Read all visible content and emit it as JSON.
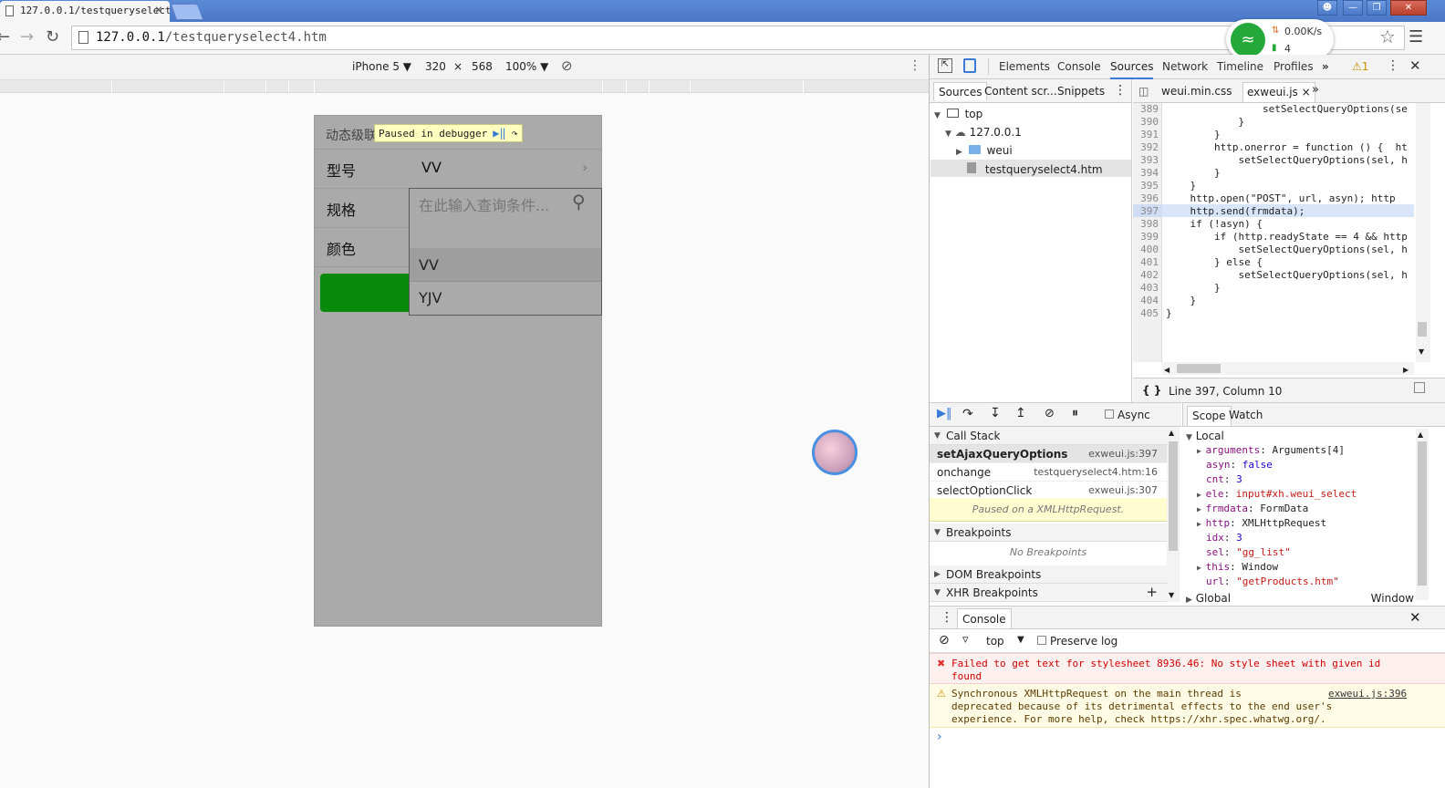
{
  "browser": {
    "tab_title": "127.0.0.1/testqueryselect4.htm",
    "tab_close": "×",
    "url_host": "127.0.0.1",
    "url_path": "/testqueryselect4.htm"
  },
  "wifi": {
    "speed": "0.00K/s",
    "devices": "4"
  },
  "device_toolbar": {
    "device": "iPhone 5",
    "width": "320",
    "times": "×",
    "height": "568",
    "zoom": "100%"
  },
  "phone": {
    "header_title": "动态级联",
    "paused_label": "Paused in debugger",
    "rows": [
      {
        "label": "型号",
        "value": "VV"
      },
      {
        "label": "规格",
        "value": ""
      },
      {
        "label": "颜色",
        "value": ""
      }
    ],
    "dropdown": {
      "placeholder": "在此输入查询条件...",
      "options": [
        "VV",
        "YJV"
      ]
    }
  },
  "devtools": {
    "tabs": [
      "Elements",
      "Console",
      "Sources",
      "Network",
      "Timeline",
      "Profiles"
    ],
    "active_tab": "Sources",
    "warning_count": "1",
    "navigator_tabs": [
      "Sources",
      "Content scr...",
      "Snippets"
    ],
    "tree": [
      {
        "label": "top",
        "depth": 0
      },
      {
        "label": "127.0.0.1",
        "depth": 1
      },
      {
        "label": "weui",
        "depth": 2
      },
      {
        "label": "testqueryselect4.htm",
        "depth": 2
      }
    ],
    "editor_tabs": [
      "weui.min.css",
      "exweui.js"
    ],
    "code_lines": [
      {
        "n": "389",
        "text": "                setSelectQueryOptions(se"
      },
      {
        "n": "390",
        "text": "            }"
      },
      {
        "n": "391",
        "text": "        }"
      },
      {
        "n": "392",
        "text": "        http.onerror = function () {  ht"
      },
      {
        "n": "393",
        "text": "            setSelectQueryOptions(sel, h"
      },
      {
        "n": "394",
        "text": "        }"
      },
      {
        "n": "395",
        "text": "    }"
      },
      {
        "n": "396",
        "text": "    http.open(\"POST\", url, asyn); http"
      },
      {
        "n": "397",
        "text": "    http.send(frmdata);"
      },
      {
        "n": "398",
        "text": "    if (!asyn) {"
      },
      {
        "n": "399",
        "text": "        if (http.readyState == 4 && http"
      },
      {
        "n": "400",
        "text": "            setSelectQueryOptions(sel, h"
      },
      {
        "n": "401",
        "text": "        } else {"
      },
      {
        "n": "402",
        "text": "            setSelectQueryOptions(sel, h"
      },
      {
        "n": "403",
        "text": "        }"
      },
      {
        "n": "404",
        "text": "    }"
      },
      {
        "n": "405",
        "text": "}"
      }
    ],
    "status": "Line 397, Column 10",
    "async_label": "Async",
    "call_stack_title": "Call Stack",
    "call_stack": [
      {
        "fn": "setAjaxQueryOptions",
        "loc": "exweui.js:397"
      },
      {
        "fn": "onchange",
        "loc": "testqueryselect4.htm:16"
      },
      {
        "fn": "selectOptionClick",
        "loc": "exweui.js:307"
      }
    ],
    "paused_msg": "Paused on a XMLHttpRequest.",
    "breakpoints_title": "Breakpoints",
    "no_breakpoints": "No Breakpoints",
    "dom_breakpoints": "DOM Breakpoints",
    "xhr_breakpoints": "XHR Breakpoints",
    "scope_tabs": [
      "Scope",
      "Watch"
    ],
    "scope_local": "Local",
    "scope_vars": [
      {
        "key": "arguments",
        "val": "Arguments[4]",
        "type": "obj",
        "expand": true
      },
      {
        "key": "asyn",
        "val": "false",
        "type": "num",
        "expand": false
      },
      {
        "key": "cnt",
        "val": "3",
        "type": "num",
        "expand": false
      },
      {
        "key": "ele",
        "val": "input#xh.weui_select",
        "type": "str",
        "expand": true
      },
      {
        "key": "frmdata",
        "val": "FormData",
        "type": "obj",
        "expand": true
      },
      {
        "key": "http",
        "val": "XMLHttpRequest",
        "type": "obj",
        "expand": true
      },
      {
        "key": "idx",
        "val": "3",
        "type": "num",
        "expand": false
      },
      {
        "key": "sel",
        "val": "\"gg_list\"",
        "type": "str",
        "expand": false
      },
      {
        "key": "this",
        "val": "Window",
        "type": "obj",
        "expand": true
      },
      {
        "key": "url",
        "val": "\"getProducts.htm\"",
        "type": "str",
        "expand": false
      }
    ],
    "scope_global": "Global",
    "scope_global_val": "Window",
    "console_tab": "Console",
    "console_context": "top",
    "preserve_log": "Preserve log",
    "error_msg": "Failed to get text for stylesheet 8936.46: No style sheet with given id\nfound",
    "warn_msg": "Synchronous XMLHttpRequest on the main thread is\ndeprecated because of its detrimental effects to the end user's\nexperience. For more help, check https://xhr.spec.whatwg.org/.",
    "warn_src": "exweui.js:396",
    "prompt": "›"
  }
}
